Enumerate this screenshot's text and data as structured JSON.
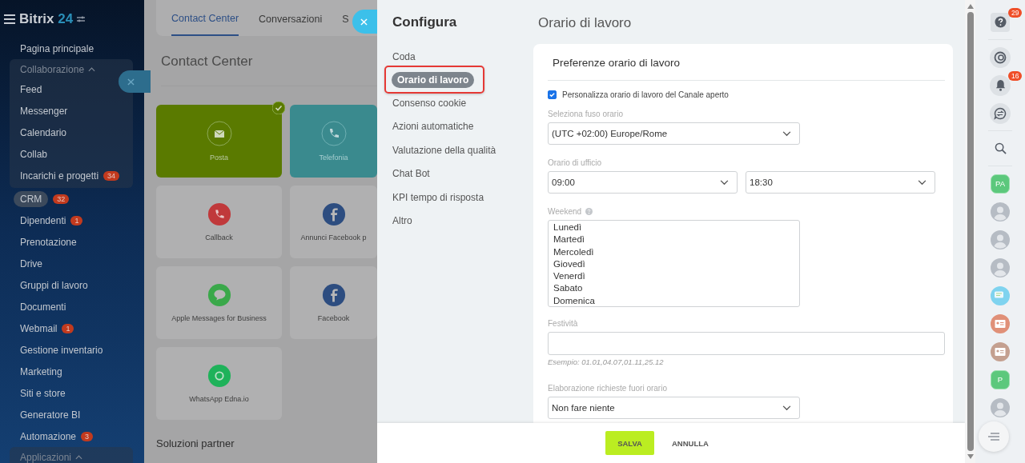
{
  "sidebar": {
    "logo": "Bitrix",
    "logo_number": "24",
    "items": [
      {
        "label": "Pagina principale",
        "kind": "link",
        "selected": false
      },
      {
        "label": "Collaborazione",
        "kind": "group",
        "expanded": true,
        "children": [
          {
            "label": "Feed"
          },
          {
            "label": "Messenger"
          },
          {
            "label": "Calendario"
          },
          {
            "label": "Collab"
          },
          {
            "label": "Incarichi e progetti",
            "badge": "34"
          }
        ]
      },
      {
        "label": "CRM",
        "kind": "link",
        "selected": true,
        "badge": "32"
      },
      {
        "label": "Dipendenti",
        "kind": "link",
        "selected": false,
        "badge": "1"
      },
      {
        "label": "Prenotazione",
        "kind": "link",
        "selected": false
      },
      {
        "label": "Drive",
        "kind": "link",
        "selected": false
      },
      {
        "label": "Gruppi di lavoro",
        "kind": "link",
        "selected": false
      },
      {
        "label": "Documenti",
        "kind": "link",
        "selected": false
      },
      {
        "label": "Webmail",
        "kind": "link",
        "selected": false,
        "badge": "1"
      },
      {
        "label": "Gestione inventario",
        "kind": "link",
        "selected": false
      },
      {
        "label": "Marketing",
        "kind": "link",
        "selected": false
      },
      {
        "label": "Siti e store",
        "kind": "link",
        "selected": false
      },
      {
        "label": "Generatore BI",
        "kind": "link",
        "selected": false
      },
      {
        "label": "Automazione",
        "kind": "link",
        "selected": false,
        "badge": "3"
      },
      {
        "label": "Applicazioni",
        "kind": "group",
        "expanded": true
      }
    ]
  },
  "background": {
    "tabs": [
      {
        "label": "Contact Center",
        "selected": true
      },
      {
        "label": "Conversazioni",
        "selected": false
      },
      {
        "label": "S",
        "selected": false
      }
    ],
    "title": "Contact Center",
    "tiles": [
      {
        "label": "Posta",
        "kind": "mail",
        "active": true,
        "checked": true
      },
      {
        "label": "Telefonia",
        "kind": "phone",
        "active": true,
        "checked": false
      },
      {
        "label": "Callback",
        "kind": "callback",
        "active": false,
        "checked": false
      },
      {
        "label": "Annunci Facebook p",
        "kind": "fbads",
        "active": false,
        "checked": false
      },
      {
        "label": "Apple Messages for Business",
        "kind": "message",
        "active": false,
        "checked": false
      },
      {
        "label": "Facebook",
        "kind": "facebook",
        "active": false,
        "checked": false
      },
      {
        "label": "WhatsApp Edna.io",
        "kind": "edna",
        "active": false,
        "checked": false
      }
    ],
    "section": "Soluzioni partner"
  },
  "panel": {
    "title": "Configura",
    "nav": [
      {
        "label": "Coda",
        "selected": false
      },
      {
        "label": "Orario di lavoro",
        "selected": true
      },
      {
        "label": "Consenso cookie",
        "selected": false
      },
      {
        "label": "Azioni automatiche",
        "selected": false
      },
      {
        "label": "Valutazione della qualità",
        "selected": false
      },
      {
        "label": "Chat Bot",
        "selected": false
      },
      {
        "label": "KPI tempo di risposta",
        "selected": false
      },
      {
        "label": "Altro",
        "selected": false
      }
    ],
    "heading": "Orario di lavoro",
    "card_title": "Preferenze orario di lavoro",
    "customize": {
      "label": "Personalizza orario di lavoro del Canale aperto",
      "checked": true
    },
    "timezone": {
      "label": "Seleziona fuso orario",
      "value": "(UTC +02:00) Europe/Rome"
    },
    "office_hours": {
      "label": "Orario di ufficio",
      "from": "09:00",
      "to": "18:30"
    },
    "weekend": {
      "label": "Weekend",
      "days": [
        {
          "label": "Lunedì",
          "selected": false
        },
        {
          "label": "Martedì",
          "selected": false
        },
        {
          "label": "Mercoledì",
          "selected": false
        },
        {
          "label": "Giovedì",
          "selected": false
        },
        {
          "label": "Venerdì",
          "selected": false
        },
        {
          "label": "Sabato",
          "selected": false
        },
        {
          "label": "Domenica",
          "selected": false
        }
      ]
    },
    "holidays": {
      "label": "Festività",
      "hint": "Esempio: 01.01,04.07,01.11,25.12"
    },
    "after_hours": {
      "label": "Elaborazione richieste fuori orario",
      "value": "Non fare niente"
    },
    "buttons": [
      {
        "label": "SALVA",
        "kind": "primary"
      },
      {
        "label": "ANNULLA",
        "kind": "link"
      }
    ]
  },
  "rail": {
    "items": [
      {
        "kind": "help",
        "badge": "29"
      },
      {
        "kind": "divider"
      },
      {
        "kind": "copilot"
      },
      {
        "kind": "bell",
        "badge": "16"
      },
      {
        "kind": "chats"
      },
      {
        "kind": "divider"
      },
      {
        "kind": "search"
      },
      {
        "kind": "divider"
      },
      {
        "kind": "hex",
        "label": "PA"
      },
      {
        "kind": "avatar"
      },
      {
        "kind": "avatar"
      },
      {
        "kind": "avatar"
      },
      {
        "kind": "chat",
        "color": "#7fd3ef"
      },
      {
        "kind": "card",
        "color": "#e09078"
      },
      {
        "kind": "card",
        "color": "#c4a090"
      },
      {
        "kind": "hex",
        "label": "P"
      },
      {
        "kind": "avatar"
      }
    ]
  }
}
